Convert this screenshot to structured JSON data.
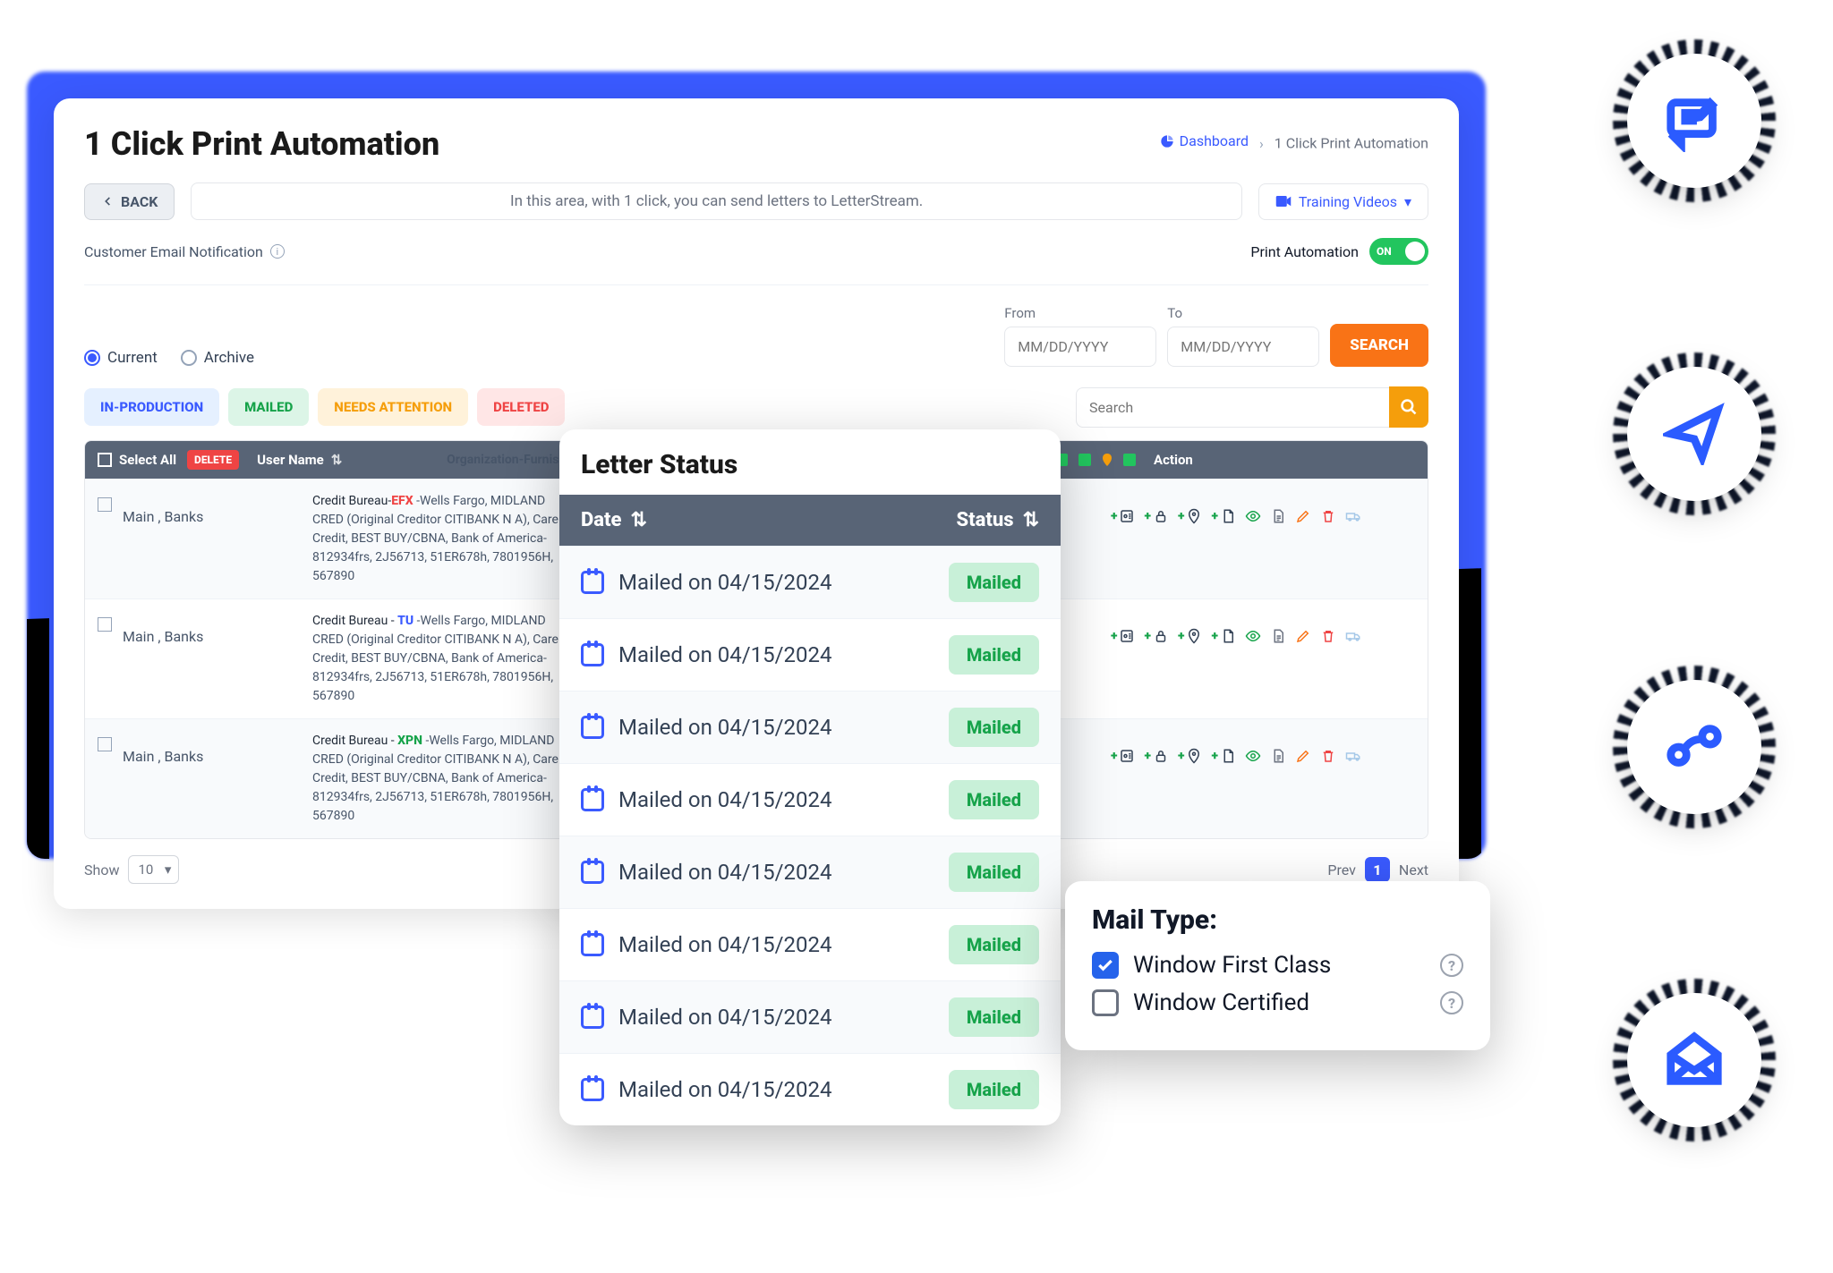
{
  "header": {
    "title": "1 Click Print Automation",
    "back_label": "BACK",
    "info": "In this area, with 1 click, you can send letters to LetterStream.",
    "training": "Training Videos",
    "crumb_dash": "Dashboard",
    "crumb_sep": "›",
    "crumb_cur": "1 Click Print Automation"
  },
  "toggle": {
    "email_label": "Customer Email Notification",
    "auto_label": "Print Automation",
    "auto_state": "ON"
  },
  "filter": {
    "current": "Current",
    "archive": "Archive",
    "from": "From",
    "to": "To",
    "date_ph": "MM/DD/YYYY",
    "search_btn": "SEARCH",
    "search_ph": "Search"
  },
  "tabs": {
    "prod": "IN-PRODUCTION",
    "mailed": "MAILED",
    "need": "NEEDS ATTENTION",
    "del": "DELETED"
  },
  "thead": {
    "select_all": "Select All",
    "delete": "DELETE",
    "user": "User Name",
    "org": "Organization-Furnisher-Accoun",
    "action": "Action"
  },
  "rows": [
    {
      "user": "Main , Banks",
      "bureau": "Credit Bureau-",
      "code": "EFX",
      "codeClass": "r",
      "rest": " -Wells Fargo, MIDLAND CRED (Original Creditor CITIBANK N A), Care Credit, BEST BUY/CBNA, Bank of America- 812934frs, 2J56713, 51ER678h, 7801956H, 567890"
    },
    {
      "user": "Main , Banks",
      "bureau": "Credit Bureau - ",
      "code": "TU",
      "codeClass": "b",
      "rest": " -Wells Fargo, MIDLAND CRED (Original Creditor CITIBANK N A), Care Credit, BEST BUY/CBNA, Bank of America- 812934frs, 2J56713, 51ER678h, 7801956H, 567890"
    },
    {
      "user": "Main , Banks",
      "bureau": "Credit Bureau - ",
      "code": "XPN",
      "codeClass": "g",
      "rest": " -Wells Fargo, MIDLAND CRED (Original Creditor CITIBANK N A), Care Credit, BEST BUY/CBNA, Bank of America- 812934frs, 2J56713, 51ER678h, 7801956H, 567890"
    }
  ],
  "pager": {
    "show": "Show",
    "size": "10",
    "prev": "Prev",
    "page": "1",
    "next": "Next"
  },
  "status": {
    "title": "Letter Status",
    "date": "Date",
    "status": "Status",
    "items": [
      {
        "text": "Mailed on 04/15/2024",
        "badge": "Mailed"
      },
      {
        "text": "Mailed on 04/15/2024",
        "badge": "Mailed"
      },
      {
        "text": "Mailed on 04/15/2024",
        "badge": "Mailed"
      },
      {
        "text": "Mailed on 04/15/2024",
        "badge": "Mailed"
      },
      {
        "text": "Mailed on 04/15/2024",
        "badge": "Mailed"
      },
      {
        "text": "Mailed on 04/15/2024",
        "badge": "Mailed"
      },
      {
        "text": "Mailed on 04/15/2024",
        "badge": "Mailed"
      },
      {
        "text": "Mailed on 04/15/2024",
        "badge": "Mailed"
      }
    ]
  },
  "mail": {
    "title": "Mail Type:",
    "opt1": "Window First Class",
    "opt2": "Window Certified"
  }
}
